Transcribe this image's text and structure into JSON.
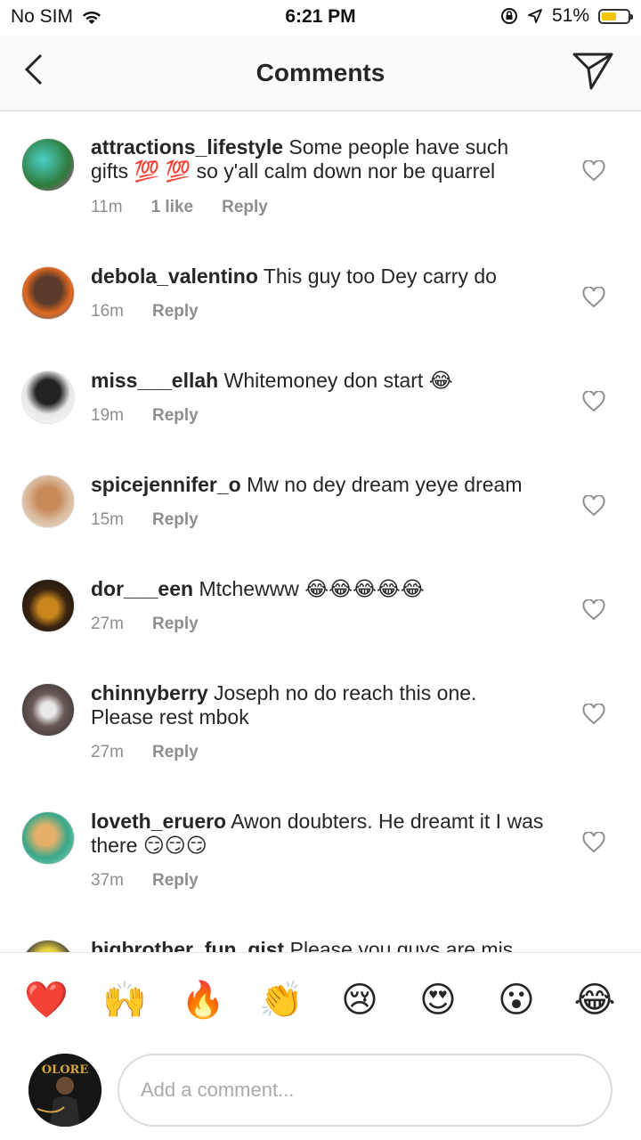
{
  "status_bar": {
    "carrier": "No SIM",
    "time": "6:21 PM",
    "battery": "51%",
    "battery_level": 0.51,
    "icons": [
      "wifi-icon",
      "orientation-lock-icon",
      "location-arrow-icon",
      "battery-icon"
    ]
  },
  "header": {
    "title": "Comments",
    "back_icon": "chevron-left-icon",
    "send_icon": "paper-plane-icon"
  },
  "comments": [
    {
      "user": "attractions_lifestyle",
      "text": "Some people have such gifts 💯 💯 so y'all calm down nor be quarrel",
      "time": "11m",
      "likes": "1 like",
      "reply": "Reply"
    },
    {
      "user": "debola_valentino",
      "text": "This guy too Dey carry do",
      "time": "16m",
      "reply": "Reply"
    },
    {
      "user": "miss___ellah",
      "text": "Whitemoney don start 😂",
      "time": "19m",
      "reply": "Reply"
    },
    {
      "user": "spicejennifer_o",
      "text": "Mw no dey dream yeye dream",
      "time": "15m",
      "reply": "Reply"
    },
    {
      "user": "dor___een",
      "text": "Mtchewww 😂😂😂😂😂",
      "time": "27m",
      "reply": "Reply"
    },
    {
      "user": "chinnyberry",
      "text": "Joseph no do reach this one. Please rest mbok",
      "time": "27m",
      "reply": "Reply"
    },
    {
      "user": "loveth_eruero",
      "text": "Awon doubters. He dreamt it I was there 😏😏😏",
      "time": "37m",
      "reply": "Reply"
    },
    {
      "user": "bigbrother_fun_gist",
      "text": "Please you guys are mis",
      "time": "",
      "reply": ""
    }
  ],
  "emoji_bar": [
    "❤️",
    "🙌",
    "🔥",
    "👏",
    "😢",
    "😍",
    "😮",
    "😂"
  ],
  "composer": {
    "placeholder": "Add a comment...",
    "avatar_text": "OLORE"
  },
  "colors": {
    "text": "#262626",
    "muted": "#8e8e8e",
    "border": "#dbdbdb",
    "battery": "#f5c400"
  }
}
